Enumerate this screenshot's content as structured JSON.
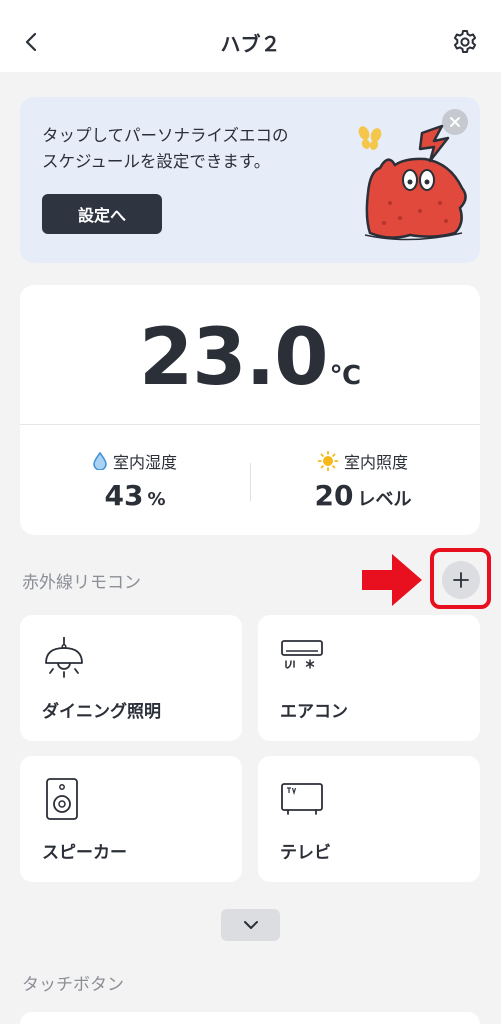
{
  "header": {
    "title": "ハブ２",
    "back_icon": "chevron-left-icon",
    "settings_icon": "gear-icon"
  },
  "banner": {
    "text": "タップしてパーソナライズエコの\nスケジュールを設定できます。",
    "button_label": "設定へ",
    "close_icon": "close-icon",
    "background": "#e7edf8"
  },
  "sensor": {
    "temperature": "23.0",
    "temperature_unit": "℃",
    "humidity": {
      "label": "室内湿度",
      "value": "43",
      "unit": "%",
      "icon": "water-drop-icon"
    },
    "illuminance": {
      "label": "室内照度",
      "value": "20",
      "unit": "レベル",
      "icon": "sun-icon"
    }
  },
  "ir_remote": {
    "section_title": "赤外線リモコン",
    "add_icon": "plus-icon",
    "highlight_color": "#e8101e",
    "devices": [
      {
        "label": "ダイニング照明",
        "icon": "ceiling-lamp-icon"
      },
      {
        "label": "エアコン",
        "icon": "air-conditioner-icon"
      },
      {
        "label": "スピーカー",
        "icon": "speaker-icon"
      },
      {
        "label": "テレビ",
        "icon": "tv-icon"
      }
    ],
    "expand_icon": "chevron-down-icon"
  },
  "touch_buttons": {
    "section_title": "タッチボタン"
  }
}
